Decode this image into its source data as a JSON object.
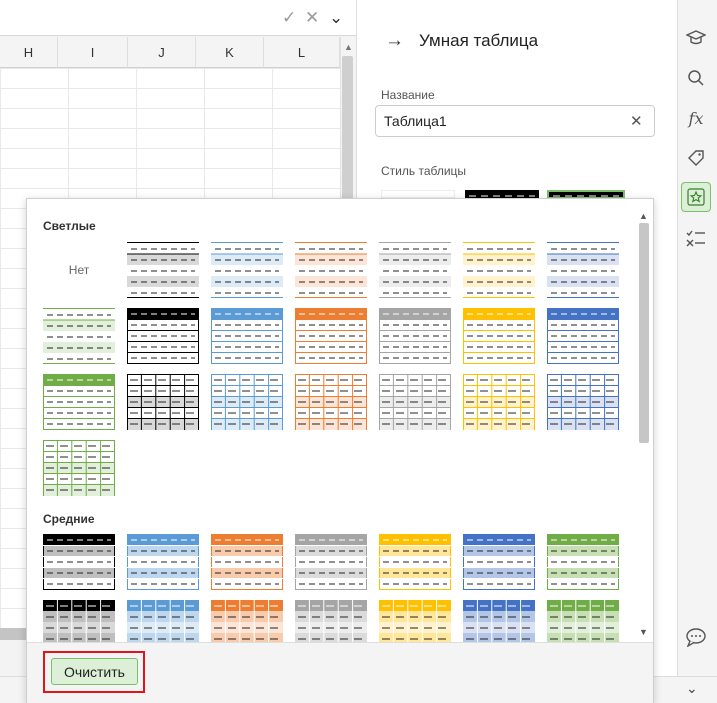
{
  "spreadsheet": {
    "columns": [
      "H",
      "I",
      "J",
      "K",
      "L"
    ]
  },
  "formula_bar": {
    "icons": [
      "checkmark-icon",
      "close-icon",
      "chevron-down-icon"
    ]
  },
  "panel": {
    "title": "Умная таблица",
    "name_label": "Название",
    "name_value": "Таблица1",
    "style_label": "Стиль таблицы"
  },
  "dropdown": {
    "light_title": "Светлые",
    "medium_title": "Средние",
    "none_label": "Нет",
    "clear_label": "Очистить"
  },
  "sidebar_icons": [
    "graduation-cap-icon",
    "search-icon",
    "function-icon",
    "tag-icon",
    "star-icon",
    "check-list-icon",
    "chat-icon"
  ],
  "colors": {
    "black": "#000000",
    "blue": "#5b9bd5",
    "orange": "#ed7d31",
    "gray": "#a5a5a5",
    "yellow": "#ffc000",
    "navy": "#4472c4",
    "green": "#70ad47",
    "accent_green": "#7cbf6a"
  }
}
